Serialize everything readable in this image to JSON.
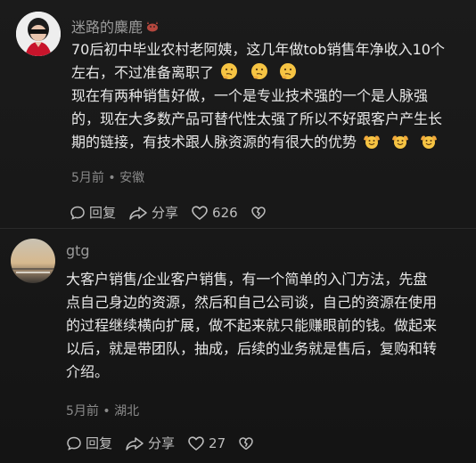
{
  "comments": [
    {
      "username": "迷路的麋鹿",
      "username_icon": "deer-icon",
      "lines": [
        "70后初中毕业农村老阿姨，这几年做tob销售年净收入10个",
        "左右，不过准备离职了",
        "现在有两种销售好做，一个是专业技术强的一个是人脉强",
        "的，现在大多数产品可替代性太强了所以不好跟客户产生长",
        "期的链接，有技术跟人脉资源的有很大的优势"
      ],
      "line2_emojis": [
        "thinking-emoji",
        "thinking-emoji",
        "thinking-emoji"
      ],
      "line5_emojis": [
        "hands-up-emoji",
        "hands-up-emoji",
        "hands-up-emoji"
      ],
      "meta": "5月前 • 安徽",
      "reply_label": "回复",
      "share_label": "分享",
      "like_count": "626"
    },
    {
      "username": "gtg",
      "lines": [
        "大客户销售/企业客户销售，有一个简单的入门方法，先盘",
        "点自己身边的资源，然后和自己公司谈，自己的资源在使用",
        "的过程继续横向扩展，做不起来就只能赚眼前的钱。做起来",
        "以后，就是带团队，抽成，后续的业务就是售后，复购和转",
        "介绍。"
      ],
      "meta": "5月前 • 湖北",
      "reply_label": "回复",
      "share_label": "分享",
      "like_count": "27"
    }
  ],
  "colors": {
    "background": "#1a1a1a",
    "text": "#e8e8e8",
    "muted": "#8a8a8a",
    "username": "#9a9a9a"
  }
}
